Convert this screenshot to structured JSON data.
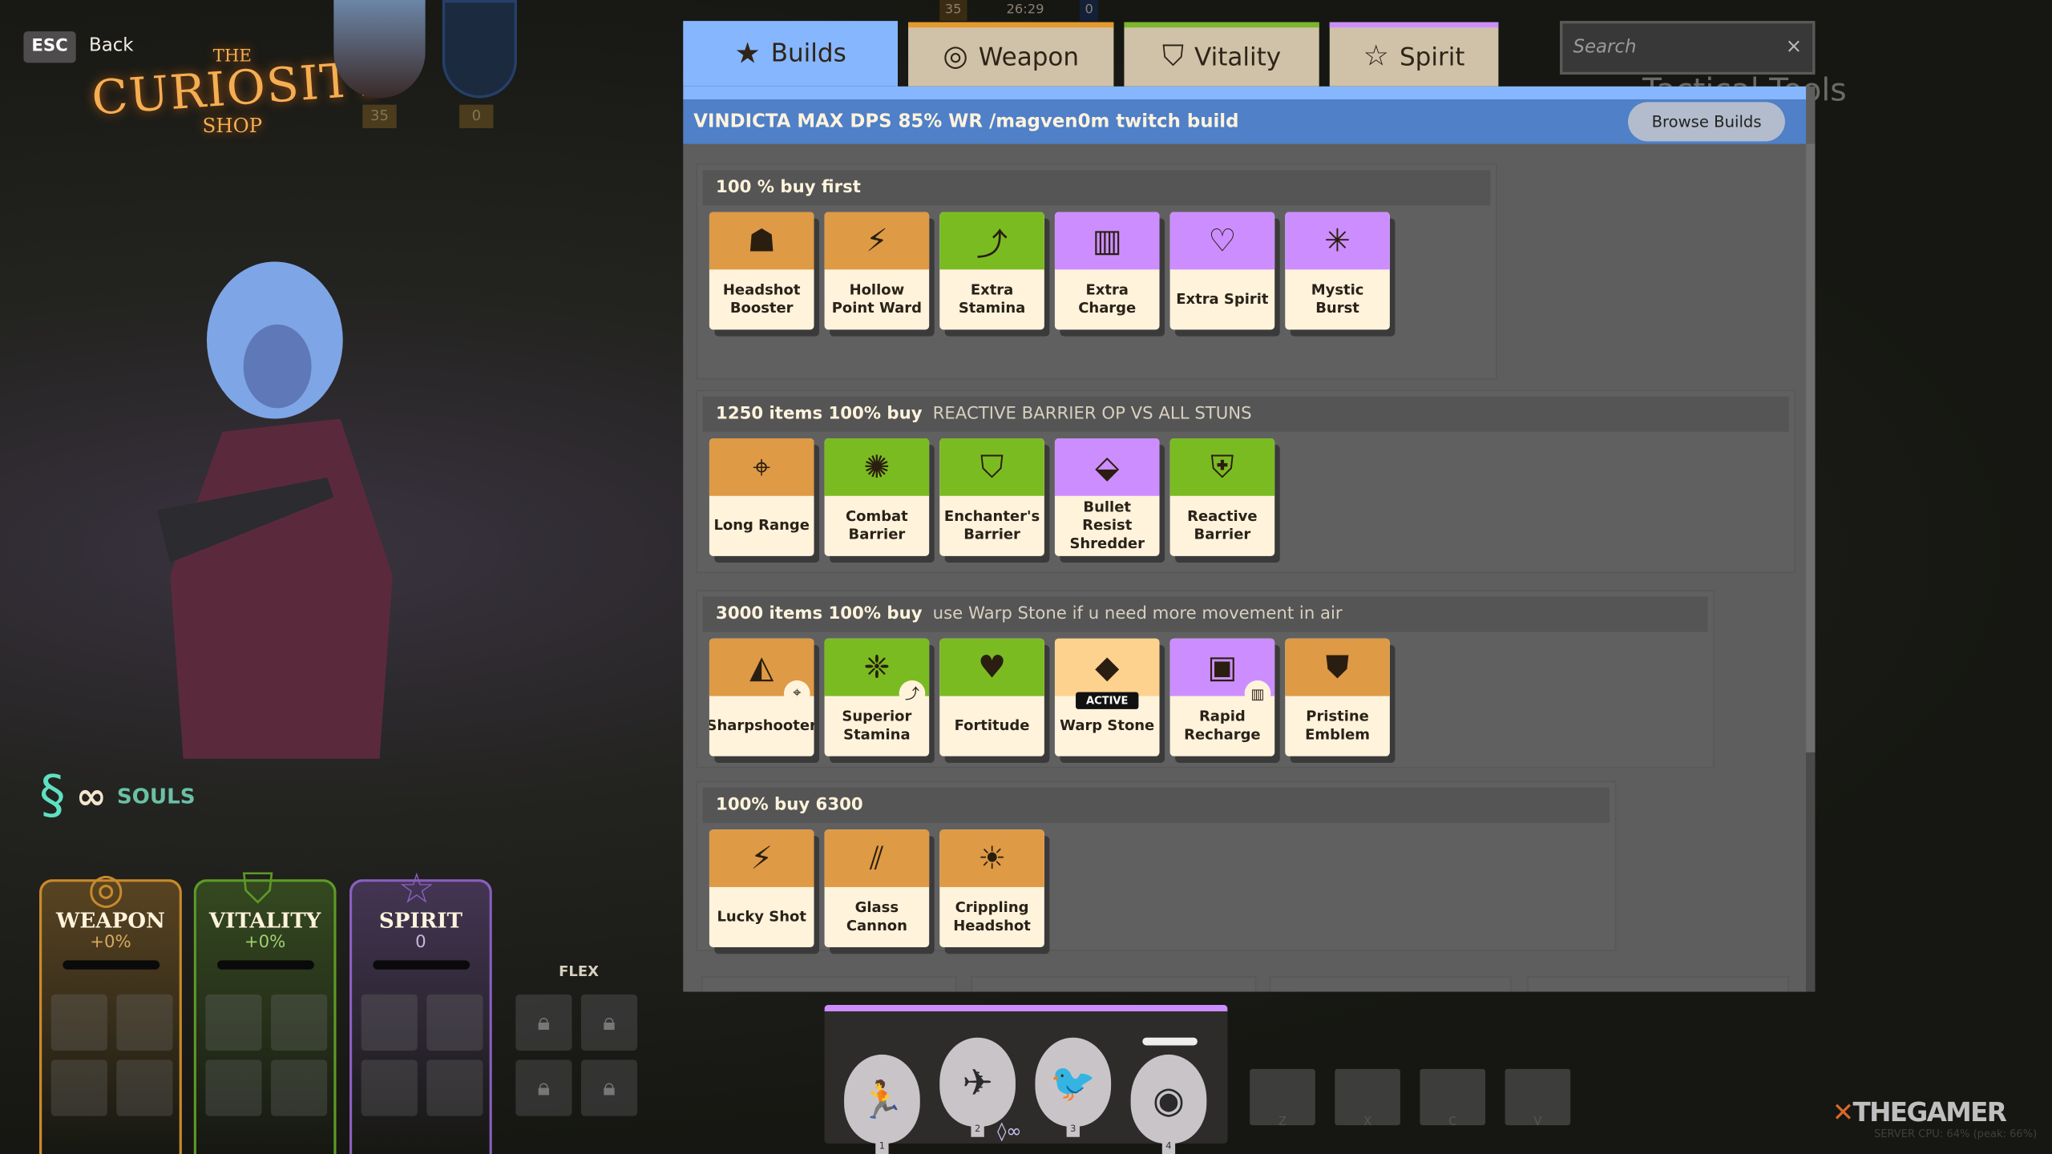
{
  "header": {
    "esc_key": "ESC",
    "back_label": "Back",
    "logo": {
      "line1": "THE",
      "line2": "CURIOSITY",
      "line3": "SHOP"
    }
  },
  "hud": {
    "team_souls": "35",
    "timer": "26:29",
    "enemy_souls": "0",
    "portraits": [
      {
        "value": "35"
      },
      {
        "value": "0"
      }
    ]
  },
  "tabs": [
    {
      "label": "Builds",
      "icon": "star-icon",
      "active": true,
      "color": "#86b6fd"
    },
    {
      "label": "Weapon",
      "icon": "weapon-icon",
      "color": "#e59a2c"
    },
    {
      "label": "Vitality",
      "icon": "vitality-shield-icon",
      "color": "#78b82a"
    },
    {
      "label": "Spirit",
      "icon": "spirit-star-icon",
      "color": "#cc8eff"
    }
  ],
  "search": {
    "placeholder": "Search",
    "clear": "×",
    "background_text": "Tactical Tools"
  },
  "build": {
    "title": "VINDICTA MAX DPS 85% WR /magven0m twitch build",
    "browse_label": "Browse Builds"
  },
  "colors": {
    "weapon": "#de9a45",
    "vitality": "#7bbb22",
    "spirit": "#cc8eff",
    "active": "#fdd28e",
    "card_bg": "#fff3dc"
  },
  "sections": [
    {
      "title": "100 % buy first",
      "note": "",
      "items": [
        {
          "name": "Headshot Booster",
          "category": "weapon",
          "icon": "☗"
        },
        {
          "name": "Hollow Point Ward",
          "category": "weapon",
          "icon": "⚡"
        },
        {
          "name": "Extra Stamina",
          "category": "vitality",
          "icon": "⤴"
        },
        {
          "name": "Extra Charge",
          "category": "spirit",
          "icon": "▥"
        },
        {
          "name": "Extra Spirit",
          "category": "spirit",
          "icon": "♡"
        },
        {
          "name": "Mystic Burst",
          "category": "spirit",
          "icon": "✳"
        }
      ]
    },
    {
      "title": "1250 items  100% buy",
      "note": "REACTIVE BARRIER OP VS ALL STUNS",
      "items": [
        {
          "name": "Long Range",
          "category": "weapon",
          "icon": "⌖"
        },
        {
          "name": "Combat Barrier",
          "category": "vitality",
          "icon": "✺"
        },
        {
          "name": "Enchanter's Barrier",
          "category": "vitality",
          "icon": "⛉"
        },
        {
          "name": "Bullet Resist Shredder",
          "category": "spirit",
          "icon": "⬙"
        },
        {
          "name": "Reactive Barrier",
          "category": "vitality",
          "icon": "⛨"
        }
      ]
    },
    {
      "title": "3000 items 100% buy",
      "note": "use Warp Stone if u need more movement in air",
      "items": [
        {
          "name": "Sharpshooter",
          "category": "weapon",
          "icon": "◭",
          "sub": "⌖"
        },
        {
          "name": "Superior Stamina",
          "category": "vitality",
          "icon": "❈",
          "sub": "⤴"
        },
        {
          "name": "Fortitude",
          "category": "vitality",
          "icon": "♥"
        },
        {
          "name": "Warp Stone",
          "category": "active",
          "icon": "◆",
          "badge": "ACTIVE"
        },
        {
          "name": "Rapid Recharge",
          "category": "spirit",
          "icon": "▣",
          "sub": "▥"
        },
        {
          "name": "Pristine Emblem",
          "category": "weapon",
          "icon": "⛊"
        }
      ]
    },
    {
      "title": "100% buy 6300",
      "note": "",
      "items": [
        {
          "name": "Lucky Shot",
          "category": "weapon",
          "icon": "⚡"
        },
        {
          "name": "Glass Cannon",
          "category": "weapon",
          "icon": "⫽"
        },
        {
          "name": "Crippling Headshot",
          "category": "weapon",
          "icon": "☀"
        }
      ]
    }
  ],
  "souls": {
    "label": "SOULS",
    "icon": "souls-icon"
  },
  "stats": [
    {
      "name": "WEAPON",
      "value": "+0%",
      "color": "#c98a2a",
      "value_color": "#d8a860",
      "icon": "◎"
    },
    {
      "name": "VITALITY",
      "value": "+0%",
      "color": "#5d9a25",
      "value_color": "#9fd070",
      "icon": "⛉"
    },
    {
      "name": "SPIRIT",
      "value": "0",
      "color": "#8a5fc0",
      "value_color": "#c8b8e0",
      "icon": "☆"
    }
  ],
  "flex": {
    "label": "FLEX"
  },
  "abilities": [
    {
      "key": "1",
      "icon": "🏃"
    },
    {
      "key": "2",
      "icon": "✈"
    },
    {
      "key": "3",
      "icon": "🐦"
    },
    {
      "key": "4",
      "icon": "◉"
    }
  ],
  "item_keys": [
    "Z",
    "X",
    "C",
    "V"
  ],
  "watermark": {
    "brand": "THEGAMER",
    "server": "SERVER CPU: 64% (peak: 66%)"
  }
}
